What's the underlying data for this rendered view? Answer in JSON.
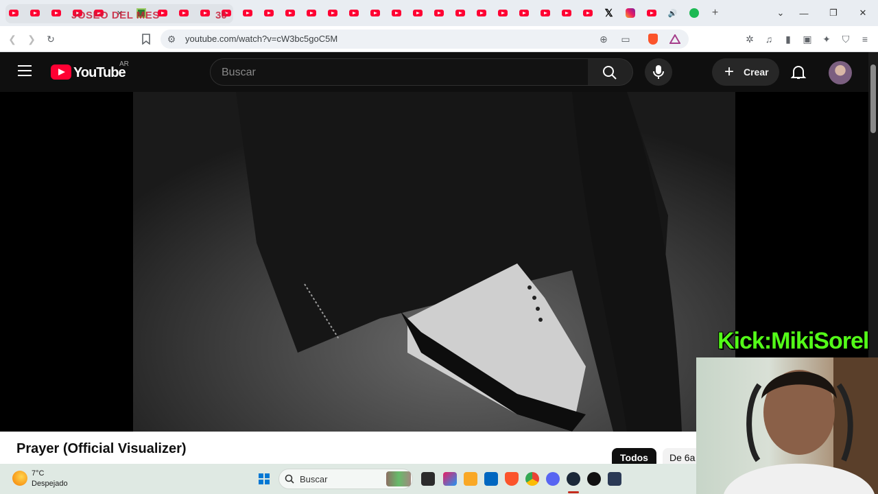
{
  "browser": {
    "tab_group_overlay_text": "JOSEO DEL MES",
    "tab_group_count": "30",
    "url": "youtube.com/watch?v=cW3bc5goC5M"
  },
  "youtube": {
    "logo_text": "YouTube",
    "country_code": "AR",
    "search_placeholder": "Buscar",
    "create_label": "Crear",
    "video_title": "Prayer (Official Visualizer)",
    "chips": [
      "Todos",
      "De 6a"
    ]
  },
  "overlay": {
    "kick_label": "Kick:MikiSorel"
  },
  "taskbar": {
    "temperature": "7°C",
    "condition": "Despejado",
    "search_label": "Buscar"
  },
  "colors": {
    "youtube_red": "#ff0033",
    "kick_green": "#53fc18"
  }
}
